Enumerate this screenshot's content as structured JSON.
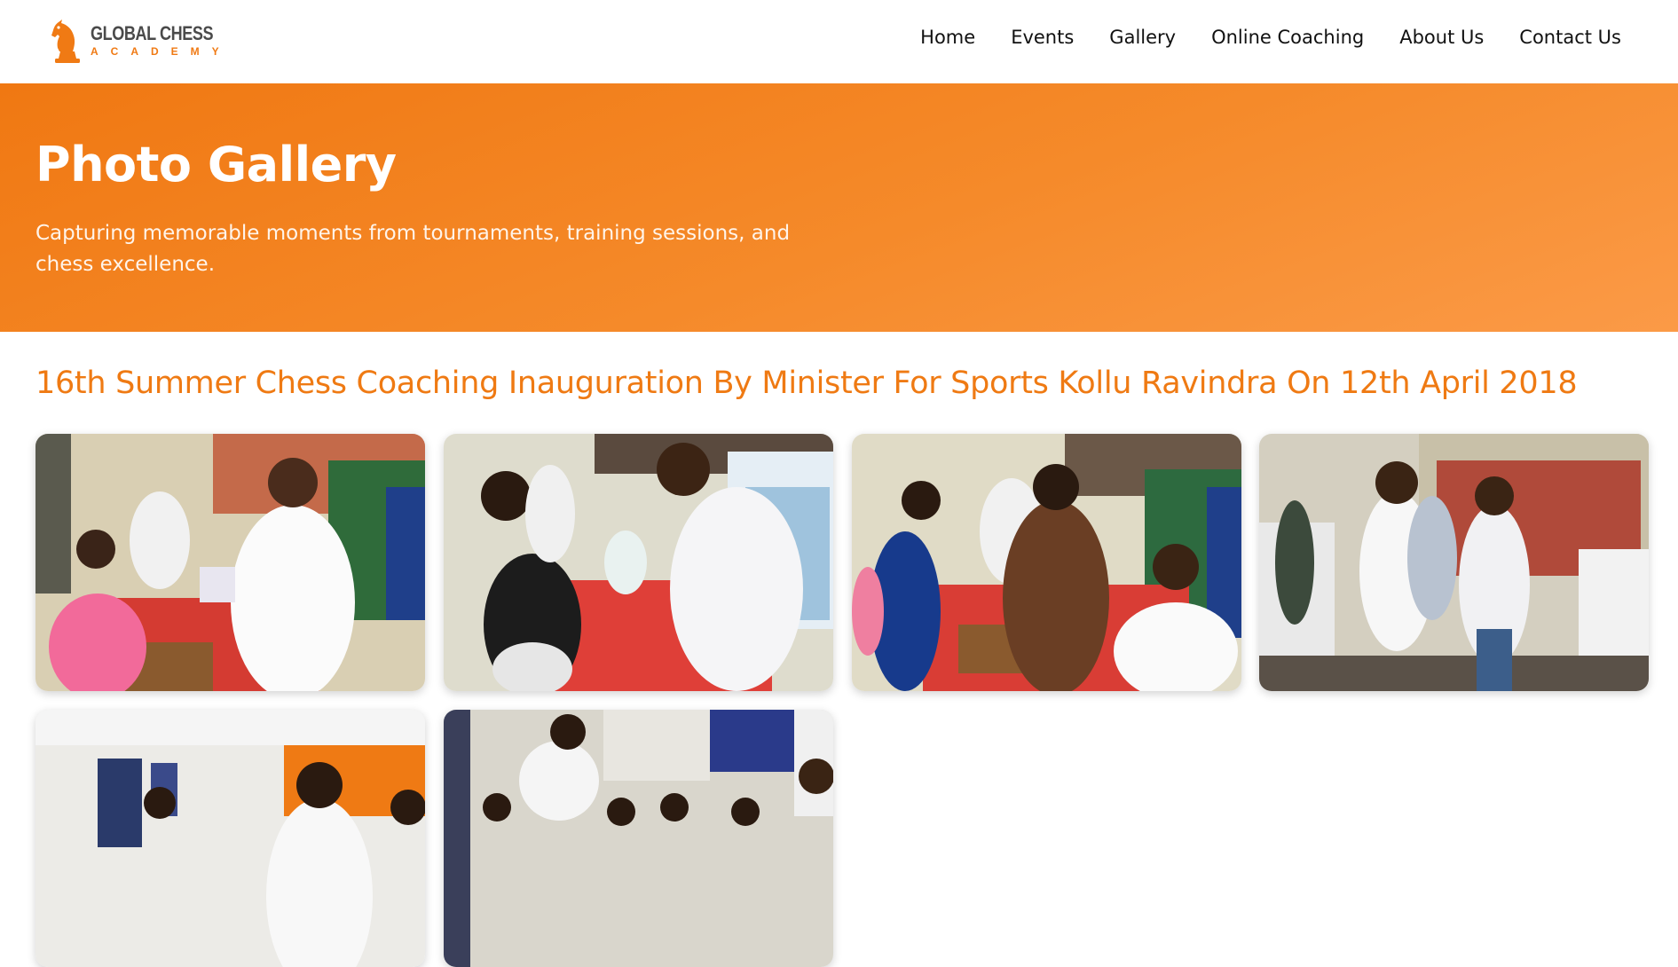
{
  "brand": {
    "title": "GLOBAL CHESS",
    "subtitle": "ACADEMY",
    "logo_icon": "knight-chess-piece-icon",
    "accent_color": "#f07a14"
  },
  "nav": {
    "items": [
      "Home",
      "Events",
      "Gallery",
      "Online Coaching",
      "About Us",
      "Contact Us"
    ]
  },
  "hero": {
    "title": "Photo Gallery",
    "subtitle": "Capturing memorable moments from tournaments, training sessions, and chess excellence.",
    "background_color": "#f58a2a"
  },
  "gallery": {
    "section_title": "16th Summer Chess Coaching Inauguration By Minister For Sports Kollu Ravindra On 12th April 2018",
    "photo_count_visible": 6
  }
}
